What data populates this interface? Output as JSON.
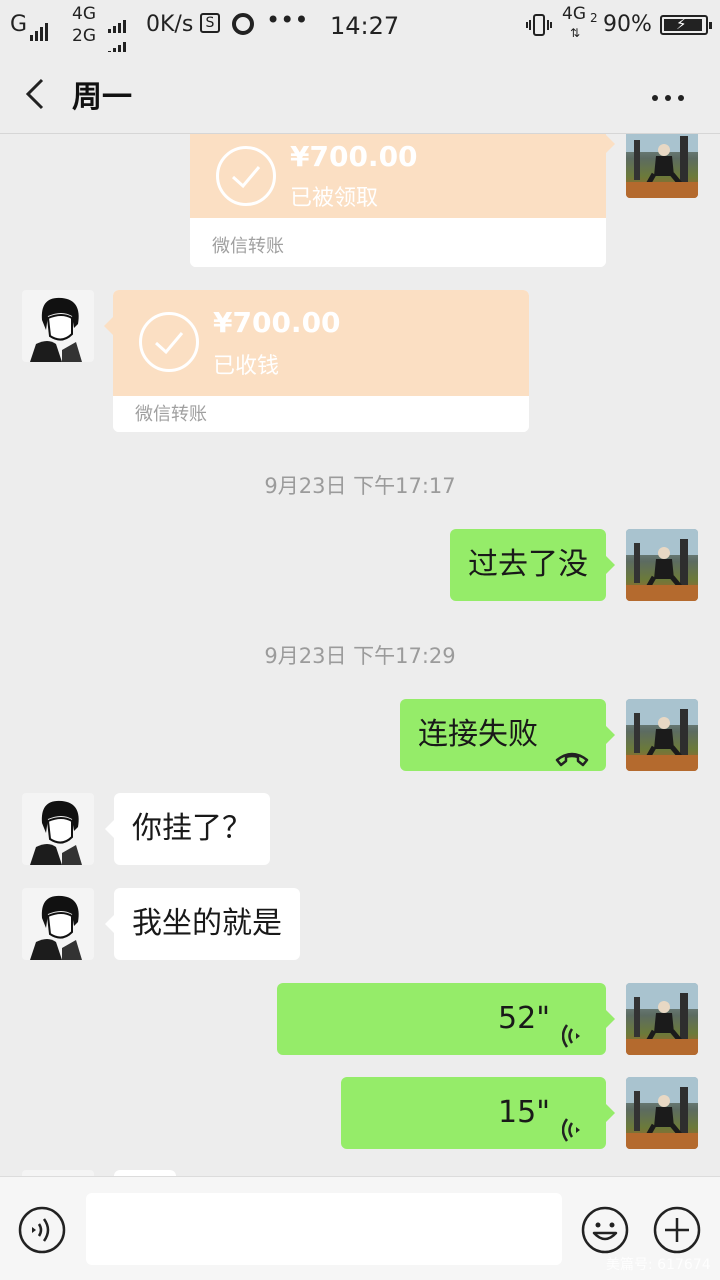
{
  "status_bar": {
    "carrier1": "G",
    "net_top": "4G",
    "net_bottom": "2G",
    "speed": "0K/s",
    "time": "14:27",
    "net_right": "4G",
    "net_right_sub": "2",
    "battery": "90%"
  },
  "nav": {
    "title": "周一"
  },
  "messages": {
    "transfer1": {
      "amount": "¥700.00",
      "status": "已被领取",
      "label": "微信转账"
    },
    "transfer2": {
      "amount": "¥700.00",
      "status": "已收钱",
      "label": "微信转账"
    },
    "time1": "9月23日 下午17:17",
    "msg1": "过去了没",
    "time2": "9月23日 下午17:29",
    "msg2": "连接失败",
    "msg3": "你挂了？",
    "msg4": "我坐的就是",
    "voice1": "52\"",
    "voice2": "15\""
  },
  "input": {
    "placeholder": ""
  },
  "watermark": "美篇号: 617674",
  "colors": {
    "green_bubble": "#95ec69",
    "transfer": "#fbdfc3",
    "background": "#ededed"
  }
}
